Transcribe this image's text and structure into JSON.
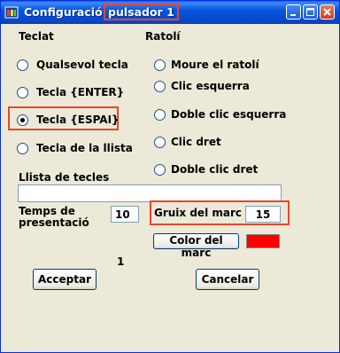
{
  "window": {
    "title_prefix": "Configuració ",
    "title_highlight": "pulsador 1",
    "minimize_icon": "minimize-icon",
    "maximize_icon": "maximize-icon",
    "close_icon": "close-icon"
  },
  "teclat": {
    "heading": "Teclat",
    "options": [
      "Qualsevol tecla",
      "Tecla {ENTER}",
      "Tecla {ESPAI}",
      "Tecla de la llista"
    ],
    "selected": 2
  },
  "ratoli": {
    "heading": "Ratolí",
    "options": [
      "Moure el ratolí",
      "Clic esquerra",
      "Doble clic esquerra",
      "Clic dret",
      "Doble clic dret"
    ]
  },
  "llista": {
    "label": "Llista de tecles",
    "value": ""
  },
  "temps": {
    "label_line1": "Temps de",
    "label_line2": "presentació",
    "value": "10"
  },
  "gruix": {
    "label": "Gruix del marc",
    "value": "15"
  },
  "color": {
    "button_label": "Color del marc",
    "swatch_color": "#FF0000"
  },
  "counter": "1",
  "buttons": {
    "accept": "Acceptar",
    "cancel": "Cancelar"
  },
  "colors": {
    "highlight": "#E8462A",
    "titlebar": "#0855DD",
    "face": "#ECE9D8"
  }
}
